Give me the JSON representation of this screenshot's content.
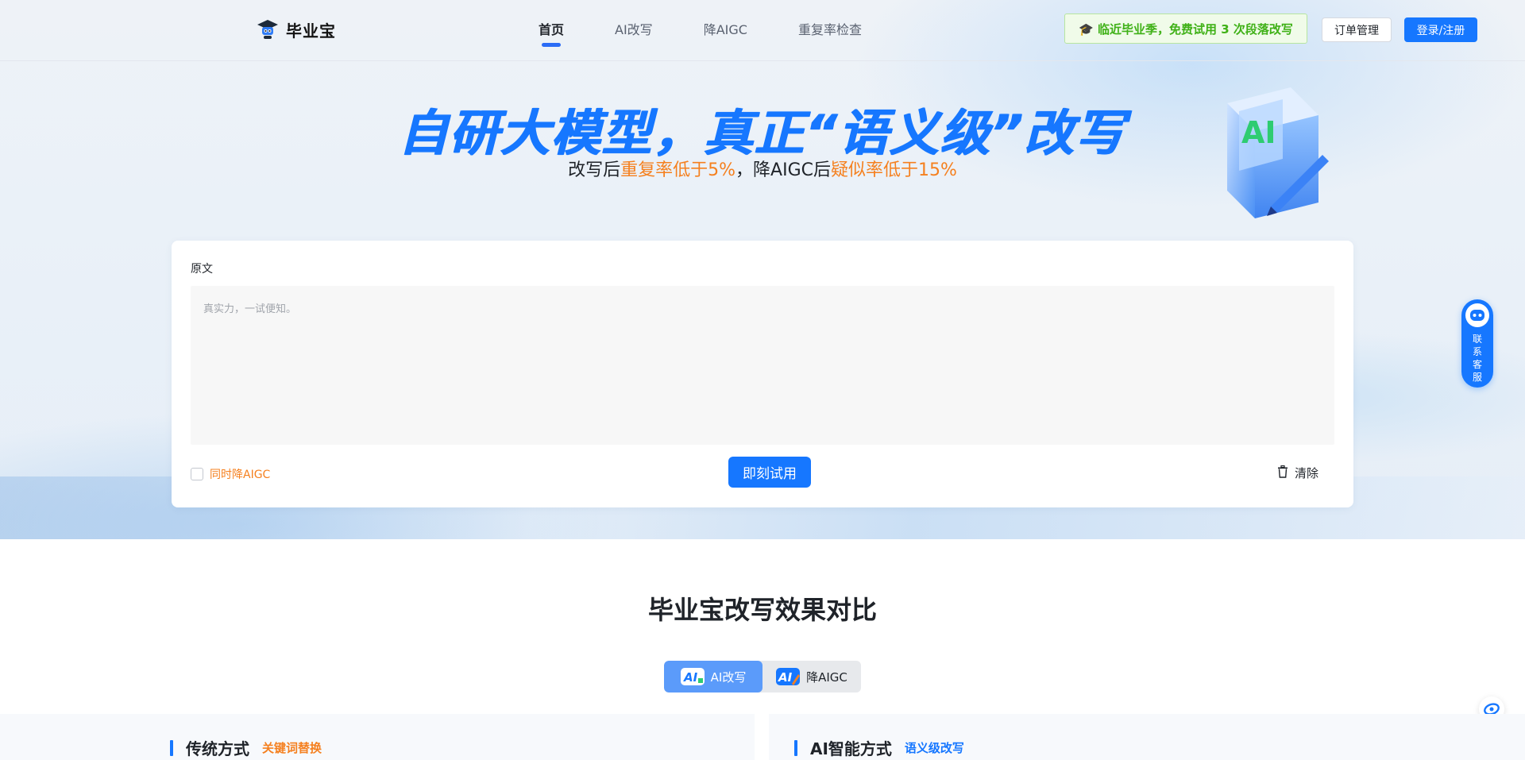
{
  "brand": {
    "name": "毕业宝"
  },
  "nav": {
    "items": [
      "首页",
      "AI改写",
      "降AIGC",
      "重复率检查"
    ],
    "active": 0
  },
  "header": {
    "promo": "🎓 临近毕业季，免费试用 3 次段落改写",
    "order_button": "订单管理",
    "login_button": "登录/注册"
  },
  "hero": {
    "title": "自研大模型，真正“语义级”改写",
    "sub_1": "改写后",
    "sub_2": "重复率低于5%",
    "sub_3": "，降AIGC后",
    "sub_4": "疑似率低于15%",
    "illus_text": "AI"
  },
  "editor": {
    "label": "原文",
    "placeholder": "真实力，一试便知。",
    "checkbox_label": "同时降AIGC",
    "checkbox_checked": false,
    "try_button": "即刻试用",
    "clear_button": "清除"
  },
  "support": {
    "label": "联系客服"
  },
  "compare": {
    "title": "毕业宝改写效果对比",
    "tabs": [
      {
        "label": "AI改写",
        "badge": "AI"
      },
      {
        "label": "降AIGC",
        "badge": "AI"
      }
    ],
    "left": {
      "title": "传统方式",
      "tag": "关键词替换"
    },
    "right": {
      "title": "AI智能方式",
      "tag": "语义级改写"
    }
  },
  "colors": {
    "primary": "#1677ff",
    "accent": "#f5801f",
    "promo_green": "#3fb117"
  }
}
